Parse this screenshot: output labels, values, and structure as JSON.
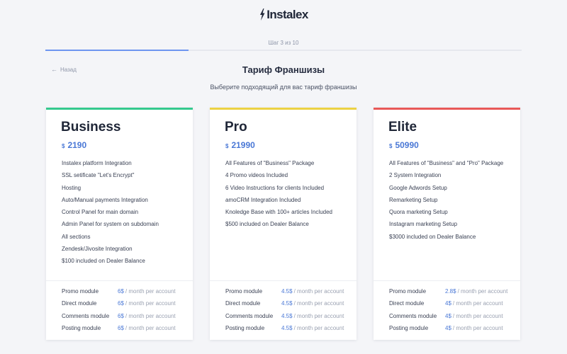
{
  "brand": {
    "name": "Instalex",
    "icon": "instalex-logo-icon"
  },
  "progress": {
    "label": "Шаг 3 из 10",
    "fraction": 0.3
  },
  "nav": {
    "back_label": "Назад",
    "back_icon": "arrow-left-icon"
  },
  "page": {
    "title": "Тариф Франшизы",
    "subtitle": "Выберите подходящий для вас тариф франшизы"
  },
  "colors": {
    "accent": "#4a78d6",
    "business": "#35c98e",
    "pro": "#ecd243",
    "elite": "#e85858"
  },
  "plans": [
    {
      "name": "Business",
      "currency": "$",
      "price": "2190",
      "features": [
        "Instalex platform Integration",
        "SSL setificate \"Let's Encrypt\"",
        "Hosting",
        "Auto/Manual payments Integration",
        "Control Panel for main domain",
        "Admin Panel for system on subdomain",
        "All sections",
        "Zendesk/Jivosite Integration",
        "$100 included on Dealer Balance"
      ],
      "modules": [
        {
          "name": "Promo module",
          "price": "6$",
          "suffix": "/ month per account"
        },
        {
          "name": "Direct module",
          "price": "6$",
          "suffix": "/ month per account"
        },
        {
          "name": "Comments module",
          "price": "6$",
          "suffix": "/ month per account"
        },
        {
          "name": "Posting module",
          "price": "6$",
          "suffix": "/ month per account"
        }
      ]
    },
    {
      "name": "Pro",
      "currency": "$",
      "price": "21990",
      "features": [
        "All Features of \"Business\" Package",
        "4 Promo videos Included",
        "6 Video Instructions for clients Included",
        "amoCRM Integration Included",
        "Knoledge Base with 100+ articles Included",
        "$500 included on Dealer Balance"
      ],
      "modules": [
        {
          "name": "Promo module",
          "price": "4.5$",
          "suffix": "/ month per account"
        },
        {
          "name": "Direct module",
          "price": "4.5$",
          "suffix": "/ month per account"
        },
        {
          "name": "Comments module",
          "price": "4.5$",
          "suffix": "/ month per account"
        },
        {
          "name": "Posting module",
          "price": "4.5$",
          "suffix": "/ month per account"
        }
      ]
    },
    {
      "name": "Elite",
      "currency": "$",
      "price": "50990",
      "features": [
        "All Features of \"Business\" and \"Pro\" Package",
        "2 System Integration",
        "Google Adwords Setup",
        "Remarketing Setup",
        "Quora marketing Setup",
        "Instagram marketing Setup",
        "$3000 included on Dealer Balance"
      ],
      "modules": [
        {
          "name": "Promo module",
          "price": "2.8$",
          "suffix": "/ month per account"
        },
        {
          "name": "Direct module",
          "price": "4$",
          "suffix": "/ month per account"
        },
        {
          "name": "Comments module",
          "price": "4$",
          "suffix": "/ month per account"
        },
        {
          "name": "Posting module",
          "price": "4$",
          "suffix": "/ month per account"
        }
      ]
    }
  ]
}
